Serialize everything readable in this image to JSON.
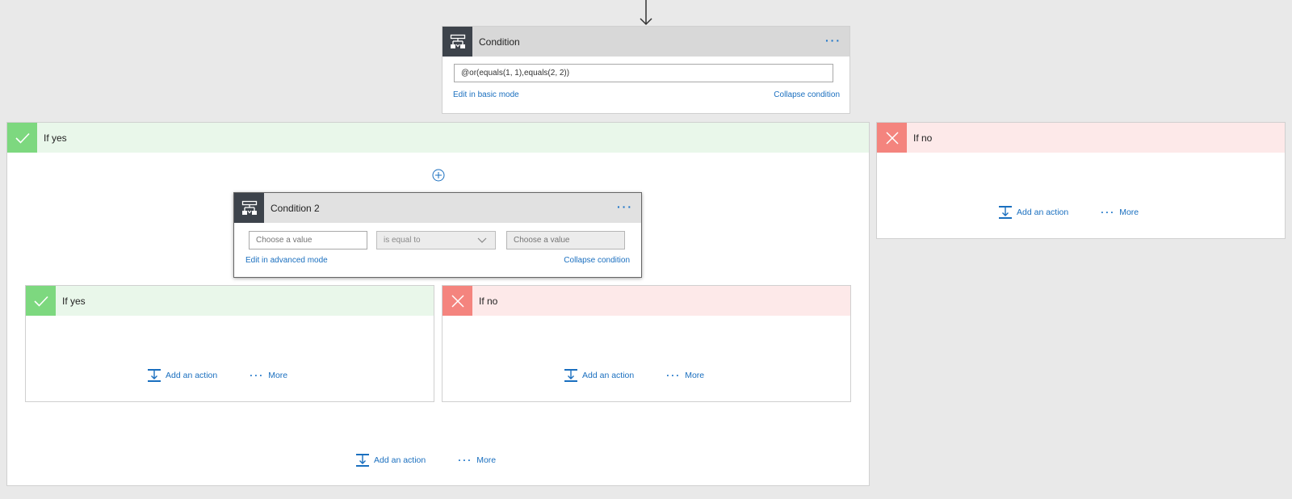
{
  "colors": {
    "accent": "#1a6fbf",
    "yes_icon_bg": "#7dd87f",
    "no_icon_bg": "#f4847e",
    "yes_header_bg": "#e9f7ea",
    "no_header_bg": "#fde9e9",
    "condition_icon_bg": "#3d434b"
  },
  "condition": {
    "title": "Condition",
    "expression_value": "@or(equals(1, 1),equals(2, 2))",
    "edit_mode_link": "Edit in basic mode",
    "collapse_link": "Collapse condition",
    "icon": "condition-icon"
  },
  "if_yes": {
    "title": "If yes",
    "icon": "checkmark-icon",
    "add_action_label": "Add an action",
    "more_label": "More",
    "condition2": {
      "title": "Condition 2",
      "icon": "condition-icon",
      "left_value_placeholder": "Choose a value",
      "operator_value": "is equal to",
      "right_value_placeholder": "Choose a value",
      "edit_mode_link": "Edit in advanced mode",
      "collapse_link": "Collapse condition",
      "if_yes": {
        "title": "If yes",
        "add_action_label": "Add an action",
        "more_label": "More"
      },
      "if_no": {
        "title": "If no",
        "add_action_label": "Add an action",
        "more_label": "More"
      }
    }
  },
  "if_no": {
    "title": "If no",
    "icon": "close-x-icon",
    "add_action_label": "Add an action",
    "more_label": "More"
  }
}
